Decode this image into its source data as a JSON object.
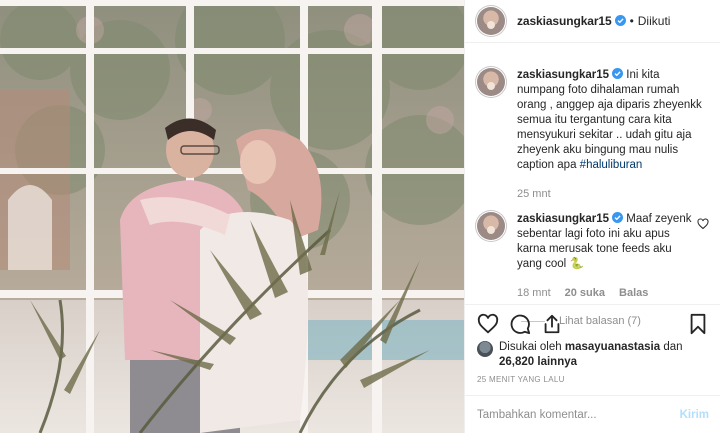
{
  "post": {
    "photo_alt": "photo",
    "username": "zaskiasungkar15",
    "follow_dot": "•",
    "follow_label": "Diikuti"
  },
  "caption": {
    "username": "zaskiasungkar15",
    "text": "Ini kita numpang foto dihalaman rumah orang , anggep aja diparis zheyenkk semua itu tergantung cara kita mensyukuri sekitar .. udah gitu aja zheyenk aku bingung mau nulis caption apa",
    "hashtag": "#haluliburan",
    "time": "25 mnt"
  },
  "comment": {
    "username": "zaskiasungkar15",
    "text": "Maaf zeyenk sebentar lagi foto ini aku apus karna merusak tone feeds aku yang cool",
    "emoji": "🐍",
    "time": "18 mnt",
    "likes": "20 suka",
    "reply": "Balas",
    "view_replies": "Lihat balasan (7)"
  },
  "likes": {
    "prefix": "Disukai oleh",
    "liker": "masayuanastasia",
    "joiner": "dan",
    "count": "26,820",
    "suffix": "lainnya"
  },
  "timestamp": "25 MENIT YANG LALU",
  "composer": {
    "placeholder": "Tambahkan komentar...",
    "send": "Kirim"
  },
  "colors": {
    "link": "#00376b",
    "verified": "#3897f0",
    "muted": "#8e8e8e",
    "send_disabled": "#b2dffc"
  },
  "icons": [
    "verified-badge-icon",
    "heart-icon",
    "comment-icon",
    "share-icon",
    "bookmark-icon",
    "comment-like-heart-icon"
  ]
}
